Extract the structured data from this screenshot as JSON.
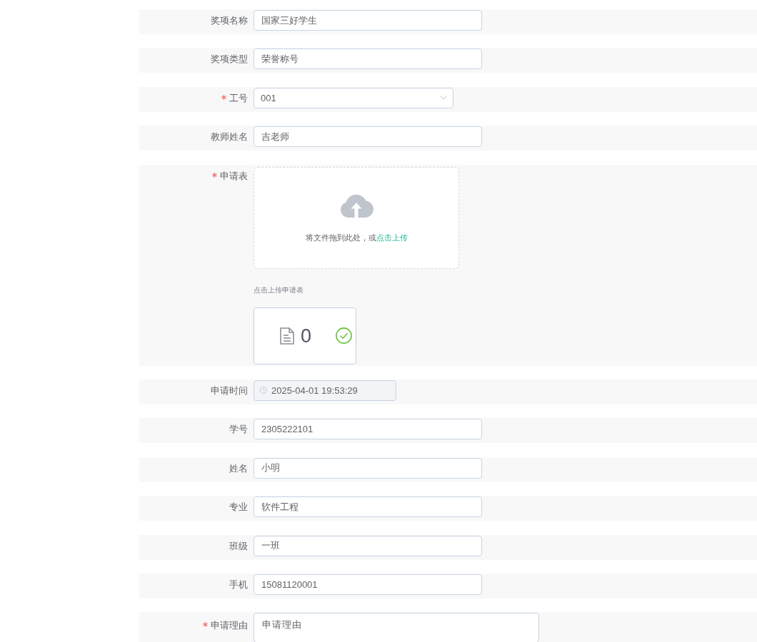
{
  "form": {
    "fields": [
      {
        "kind": "input",
        "label": "奖项名称",
        "required": false,
        "value": "国家三好学生"
      },
      {
        "kind": "input",
        "label": "奖项类型",
        "required": false,
        "value": "荣誉称号"
      },
      {
        "kind": "select",
        "label": "工号",
        "required": true,
        "value": "001"
      },
      {
        "kind": "input",
        "label": "教师姓名",
        "required": false,
        "value": "吉老师"
      },
      {
        "kind": "upload",
        "label": "申请表",
        "required": true,
        "drop_text": "将文件拖到此处，或",
        "drop_link": "点击上传",
        "tip": "点击上传申请表",
        "files": [
          {
            "name": "0",
            "success": true
          }
        ]
      },
      {
        "kind": "datetime",
        "label": "申请时间",
        "required": false,
        "disabled": true,
        "value": "2025-04-01 19:53:29"
      },
      {
        "kind": "input",
        "label": "学号",
        "required": false,
        "value": "2305222101"
      },
      {
        "kind": "input",
        "label": "姓名",
        "required": false,
        "value": "小明"
      },
      {
        "kind": "input",
        "label": "专业",
        "required": false,
        "value": "软件工程"
      },
      {
        "kind": "input",
        "label": "班级",
        "required": false,
        "value": "一班"
      },
      {
        "kind": "input",
        "label": "手机",
        "required": false,
        "value": "15081120001"
      },
      {
        "kind": "textarea",
        "label": "申请理由",
        "required": true,
        "value": "申请理由"
      }
    ]
  }
}
